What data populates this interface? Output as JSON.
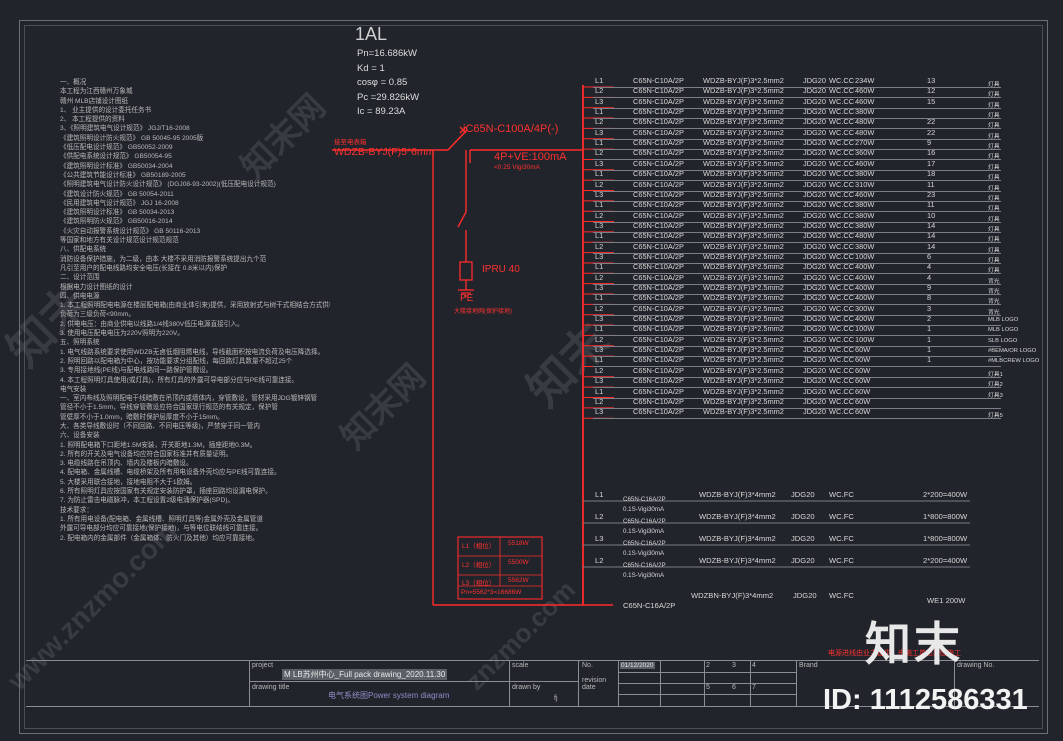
{
  "panel_title": "1AL",
  "params": [
    "Pn=16.686kW",
    "Kd = 1",
    "cosφ = 0.85",
    "Pc =29.826kW",
    "Ic = 89.23A"
  ],
  "incoming": {
    "label": "接至电表箱",
    "cable": "WDZB-BYJ(F)5*6mm",
    "breaker": "iC65N-C100A/4P(-)",
    "rcd": "4P+VE:100mA",
    "rcd_sub": "<0.25 Vigi30mA",
    "spd": "IPRU 40",
    "pe": "PE",
    "pe_note": "大楼接地网(保护接地)"
  },
  "notes": [
    "一、概况",
    "本工程为江西赣州万象城",
    "赣州    MLB店铺设计图纸",
    "1、 业主提供的设计委托任务书",
    "2、 本工程提供的资料",
    "3、《照明建筑电气设计规范》    JGJ/T16-2008",
    "《建筑照明设计防火规范》    GB 50045-95  2005版",
    "《低压配电设计规范》    GB50052-2009",
    "《供配电系统设计规范》    GB50054-95",
    "《建筑照明设计标准》    GB50034-2004",
    "《公共建筑节能设计标准》    GB50189-2005",
    "《照明建筑电气设计防火设计规范》    (DGJ08-93-2002)(低压配电设计规范)",
    "《建筑设计防火规范》    GB 50054-2011",
    "《民用建筑电气设计规范》    JGJ 16-2008",
    "《建筑照明设计标准》    GB 50034-2013",
    "《建筑照明防火规范》    GB50016-2014",
    "《火灾自动报警系统设计规范》    GB 50116-2013",
    "等国家和地方有关设计规范设计规范规范",
    "八、供配电系统",
    "消防设备保护措施，为二级，由本    大楼不采用消防报警系统提出九个范",
    "凡引至用户的配电线路均安全电压(长接在    0.8米以内)保护",
    "二、设计范围",
    "根据电力设计图纸的设计",
    "四、供电电源",
    "1. 本工程照明配电电源在楼层配电箱(由商业体引来)提供，采用放射式与树干式相结合方式供电",
    "负荷为三级负荷<90mm。",
    "2. 供电电压：由商业供电以线路1/4线380V低压电源直接引入。",
    "3. 使用电压配电电压为220V照明为220V。",
    "五、照明系统",
    "1. 电气线路系统要求使用WDZB无卤低烟阻燃电线，导线截面积按电流负荷及电压降选择。",
    "2. 照明回路以配电箱为中心，按功能要求分组配线，每回路灯具数量不超过25个",
    "3. 专用接地线(PE线)与配电线路同一路保护管敷设。",
    "4. 本工程照明灯具使用(或灯具)，所有灯具的外露可导电部分应与PE线可靠连接。",
    "电气安装",
    "一、室内布线及照明配电干线暗敷在吊顶内或墙体内，穿管敷设，管材采用JDG镀锌钢管",
    "管径不小于1.5mm，导线穿管敷设应符合国家现行规范的有关规定，保护管",
    "管壁厚不小于1.0mm，暗敷时保护层厚度不小于15mm。",
    "大、各类导线敷设时（不同回路、不同电压等级)，严禁穿于同一管内",
    "六、设备安装",
    "1. 照明配电箱下口距地1.5M安装，开关距地1.3M，插座距地0.3M。",
    "2. 所有的开关及电气设备均应符合国家标准并有质量证明。",
    "3. 电缆线路在吊顶内、墙内及楼板内暗敷设。",
    "4. 配电箱、金属线槽、电缆桥架及所有用电设备外壳均应与PE线可靠连接。",
    "5. 大楼采用联合接地，接地电阻不大于1欧姆。",
    "6. 所有照明灯具应按国家有关规定安装防护罩，插座回路均设漏电保护。",
    "7. 为防止雷击电磁脉冲，本工程设置2级电涌保护器(SPD)。",
    "技术要求：",
    "1. 所有用电设备(配电箱、金属线槽、照明灯具等)金属外壳及金属管道",
    "外露可导电部分均应可靠接地(保护接地)，与等电位联结线可靠连接。",
    "2. 配电箱内的金属部件（金属箱体、防火门及其他）均应可靠接地。"
  ],
  "branches": [
    {
      "phase": "L1",
      "breaker": "C65N-C10A/2P",
      "cable": "WDZB-BYJ(F)3*2.5mm2",
      "conduit": "JDG20",
      "lay": "WC.CC",
      "power": "234W",
      "count": "13",
      "label": "灯具"
    },
    {
      "phase": "L2",
      "breaker": "C65N-C10A/2P",
      "cable": "WDZB-BYJ(F)3*2.5mm2",
      "conduit": "JDG20",
      "lay": "WC.CC",
      "power": "460W",
      "count": "12",
      "label": "灯具"
    },
    {
      "phase": "L3",
      "breaker": "C65N-C10A/2P",
      "cable": "WDZB-BYJ(F)3*2.5mm2",
      "conduit": "JDG20",
      "lay": "WC.CC",
      "power": "460W",
      "count": "15",
      "label": "灯具"
    },
    {
      "phase": "L1",
      "breaker": "C65N-C10A/2P",
      "cable": "WDZB-BYJ(F)3*2.5mm2",
      "conduit": "JDG20",
      "lay": "WC.CC",
      "power": "380W",
      "count": "",
      "label": "灯具"
    },
    {
      "phase": "L2",
      "breaker": "C65N-C10A/2P",
      "cable": "WDZB-BYJ(F)3*2.5mm2",
      "conduit": "JDG20",
      "lay": "WC.CC",
      "power": "480W",
      "count": "22",
      "label": "灯具"
    },
    {
      "phase": "L3",
      "breaker": "C65N-C10A/2P",
      "cable": "WDZB-BYJ(F)3*2.5mm2",
      "conduit": "JDG20",
      "lay": "WC.CC",
      "power": "480W",
      "count": "22",
      "label": "灯具"
    },
    {
      "phase": "L1",
      "breaker": "C65N-C10A/2P",
      "cable": "WDZB-BYJ(F)3*2.5mm2",
      "conduit": "JDG20",
      "lay": "WC.CC",
      "power": "270W",
      "count": "9",
      "label": "灯具"
    },
    {
      "phase": "L2",
      "breaker": "C65N-C10A/2P",
      "cable": "WDZB-BYJ(F)3*2.5mm2",
      "conduit": "JDG20",
      "lay": "WC.CC",
      "power": "360W",
      "count": "16",
      "label": "灯具"
    },
    {
      "phase": "L3",
      "breaker": "C65N-C10A/2P",
      "cable": "WDZB-BYJ(F)3*2.5mm2",
      "conduit": "JDG20",
      "lay": "WC.CC",
      "power": "460W",
      "count": "17",
      "label": "灯具"
    },
    {
      "phase": "L1",
      "breaker": "C65N-C10A/2P",
      "cable": "WDZB-BYJ(F)3*2.5mm2",
      "conduit": "JDG20",
      "lay": "WC.CC",
      "power": "380W",
      "count": "18",
      "label": "灯具"
    },
    {
      "phase": "L2",
      "breaker": "C65N-C10A/2P",
      "cable": "WDZB-BYJ(F)3*2.5mm2",
      "conduit": "JDG20",
      "lay": "WC.CC",
      "power": "310W",
      "count": "11",
      "label": "灯具"
    },
    {
      "phase": "L3",
      "breaker": "C65N-C10A/2P",
      "cable": "WDZB-BYJ(F)3*2.5mm2",
      "conduit": "JDG20",
      "lay": "WC.CC",
      "power": "460W",
      "count": "23",
      "label": "灯具"
    },
    {
      "phase": "L1",
      "breaker": "C65N-C10A/2P",
      "cable": "WDZB-BYJ(F)3*2.5mm2",
      "conduit": "JDG20",
      "lay": "WC.CC",
      "power": "380W",
      "count": "11",
      "label": "灯具"
    },
    {
      "phase": "L2",
      "breaker": "C65N-C10A/2P",
      "cable": "WDZB-BYJ(F)3*2.5mm2",
      "conduit": "JDG20",
      "lay": "WC.CC",
      "power": "380W",
      "count": "10",
      "label": "灯具"
    },
    {
      "phase": "L3",
      "breaker": "C65N-C10A/2P",
      "cable": "WDZB-BYJ(F)3*2.5mm2",
      "conduit": "JDG20",
      "lay": "WC.CC",
      "power": "380W",
      "count": "14",
      "label": "灯具"
    },
    {
      "phase": "L1",
      "breaker": "C65N-C10A/2P",
      "cable": "WDZB-BYJ(F)3*2.5mm2",
      "conduit": "JDG20",
      "lay": "WC.CC",
      "power": "480W",
      "count": "14",
      "label": "灯具"
    },
    {
      "phase": "L2",
      "breaker": "C65N-C10A/2P",
      "cable": "WDZB-BYJ(F)3*2.5mm2",
      "conduit": "JDG20",
      "lay": "WC.CC",
      "power": "380W",
      "count": "14",
      "label": "灯具"
    },
    {
      "phase": "L3",
      "breaker": "C65N-C10A/2P",
      "cable": "WDZB-BYJ(F)3*2.5mm2",
      "conduit": "JDG20",
      "lay": "WC.CC",
      "power": "100W",
      "count": "6",
      "label": "灯具"
    },
    {
      "phase": "L1",
      "breaker": "C65N-C10A/2P",
      "cable": "WDZB-BYJ(F)3*2.5mm2",
      "conduit": "JDG20",
      "lay": "WC.CC",
      "power": "400W",
      "count": "4",
      "label": "灯具"
    },
    {
      "phase": "L2",
      "breaker": "C65N-C10A/2P",
      "cable": "WDZB-BYJ(F)3*2.5mm2",
      "conduit": "JDG20",
      "lay": "WC.CC",
      "power": "400W",
      "count": "4",
      "label": "背光"
    },
    {
      "phase": "L3",
      "breaker": "C65N-C10A/2P",
      "cable": "WDZB-BYJ(F)3*2.5mm2",
      "conduit": "JDG20",
      "lay": "WC.CC",
      "power": "400W",
      "count": "9",
      "label": "背光"
    },
    {
      "phase": "L1",
      "breaker": "C65N-C10A/2P",
      "cable": "WDZB-BYJ(F)3*2.5mm2",
      "conduit": "JDG20",
      "lay": "WC.CC",
      "power": "400W",
      "count": "8",
      "label": "背光"
    },
    {
      "phase": "L2",
      "breaker": "C65N-C10A/2P",
      "cable": "WDZB-BYJ(F)3*2.5mm2",
      "conduit": "JDG20",
      "lay": "WC.CC",
      "power": "300W",
      "count": "3",
      "label": "背光"
    },
    {
      "phase": "L3",
      "breaker": "C65N-C10A/2P",
      "cable": "WDZB-BYJ(F)3*2.5mm2",
      "conduit": "JDG20",
      "lay": "WC.CC",
      "power": "400W",
      "count": "2",
      "label": "MLB LOGO"
    },
    {
      "phase": "L1",
      "breaker": "C65N-C10A/2P",
      "cable": "WDZB-BYJ(F)3*2.5mm2",
      "conduit": "JDG20",
      "lay": "WC.CC",
      "power": "100W",
      "count": "1",
      "label": "MLB LOGO"
    },
    {
      "phase": "L2",
      "breaker": "C65N-C10A/2P",
      "cable": "WDZB-BYJ(F)3*2.5mm2",
      "conduit": "JDG20",
      "lay": "WC.CC",
      "power": "100W",
      "count": "1",
      "label": "SLB LOGO"
    },
    {
      "phase": "L3",
      "breaker": "C65N-C10A/2P",
      "cable": "WDZB-BYJ(F)3*2.5mm2",
      "conduit": "JDG20",
      "lay": "WC.CC",
      "power": "60W",
      "count": "1",
      "label": "#BEMA/OR LOGO"
    },
    {
      "phase": "L1",
      "breaker": "C65N-C10A/2P",
      "cable": "WDZB-BYJ(F)3*2.5mm2",
      "conduit": "JDG20",
      "lay": "WC.CC",
      "power": "60W",
      "count": "1",
      "label": "#MLBCREW LOGO"
    },
    {
      "phase": "L2",
      "breaker": "C65N-C10A/2P",
      "cable": "WDZB-BYJ(F)3*2.5mm2",
      "conduit": "JDG20",
      "lay": "WC.CC",
      "power": "60W",
      "count": "",
      "label": "灯具1"
    },
    {
      "phase": "L3",
      "breaker": "C65N-C10A/2P",
      "cable": "WDZB-BYJ(F)3*2.5mm2",
      "conduit": "JDG20",
      "lay": "WC.CC",
      "power": "60W",
      "count": "",
      "label": "灯具2"
    },
    {
      "phase": "L1",
      "breaker": "C65N-C10A/2P",
      "cable": "WDZB-BYJ(F)3*2.5mm2",
      "conduit": "JDG20",
      "lay": "WC.CC",
      "power": "60W",
      "count": "",
      "label": "灯具3"
    },
    {
      "phase": "L2",
      "breaker": "C65N-C10A/2P",
      "cable": "WDZB-BYJ(F)3*2.5mm2",
      "conduit": "JDG20",
      "lay": "WC.CC",
      "power": "60W",
      "count": "",
      "label": ""
    },
    {
      "phase": "L3",
      "breaker": "C65N-C10A/2P",
      "cable": "WDZB-BYJ(F)3*2.5mm2",
      "conduit": "JDG20",
      "lay": "WC.CC",
      "power": "60W",
      "count": "",
      "label": "灯具5"
    }
  ],
  "socket_branches": [
    {
      "phase": "L1",
      "breaker": "C65N-C16A/2P",
      "rcd": "0.1S-Vigi30mA",
      "cable": "WDZB-BYJ(F)3*4mm2",
      "conduit": "JDG20",
      "lay": "WC.FC",
      "load": "2*200=400W"
    },
    {
      "phase": "L2",
      "breaker": "C65N-C16A/2P",
      "rcd": "0.1S-Vigi30mA",
      "cable": "WDZB-BYJ(F)3*4mm2",
      "conduit": "JDG20",
      "lay": "WC.FC",
      "load": "1*800=800W"
    },
    {
      "phase": "L3",
      "breaker": "C65N-C16A/2P",
      "rcd": "0.1S-Vigi30mA",
      "cable": "WDZB-BYJ(F)3*4mm2",
      "conduit": "JDG20",
      "lay": "WC.FC",
      "load": "1*800=800W"
    },
    {
      "phase": "L2",
      "breaker": "C65N-C16A/2P",
      "rcd": "0.1S-Vigi30mA",
      "cable": "WDZB-BYJ(F)3*4mm2",
      "conduit": "JDG20",
      "lay": "WC.FC",
      "load": "2*200=400W"
    }
  ],
  "last_branch": {
    "breaker": "C65N-C16A/2P",
    "cable": "WDZBN-BYJ(F)3*4mm2",
    "conduit": "JDG20",
    "lay": "WC.FC",
    "load": "WE1   200W"
  },
  "phase_table": {
    "rows": [
      {
        "name": "L1（相位）",
        "value": "5518W"
      },
      {
        "name": "L2（相位）",
        "value": "5500W"
      },
      {
        "name": "L3（相位）",
        "value": "5562W"
      }
    ],
    "total": "Pn=5562*3=16686W"
  },
  "bottom_note": "电源进线由业主提供，由施工单位按图施工",
  "title_block": {
    "project_label": "project",
    "project": "M LB苏州中心_Full pack drawing_2020.11.30",
    "scale_label": "scale",
    "no_label": "No.",
    "rev_label": "revision date",
    "rev_date": "01/12/2020",
    "brand_label": "Brand",
    "drawing_no_label": "drawing No.",
    "drawing_title_label": "drawing title",
    "drawing_title": "电气系统图Power system diagram",
    "drawn_by_label": "drawn by",
    "drawn_by": "fj",
    "cols": [
      "2",
      "3",
      "4",
      "5",
      "6",
      "7"
    ]
  },
  "watermarks": [
    "知末",
    "www.znzmo.com",
    "知末网",
    "znzmo.com",
    "知末",
    "知末网"
  ],
  "brand_logo": "知末",
  "id_text": "ID: 1112586331",
  "colors": {
    "background": "#21252b",
    "lines": "#c9ccd2",
    "accent": "#ff2b2b",
    "text": "#d8d8d8"
  }
}
